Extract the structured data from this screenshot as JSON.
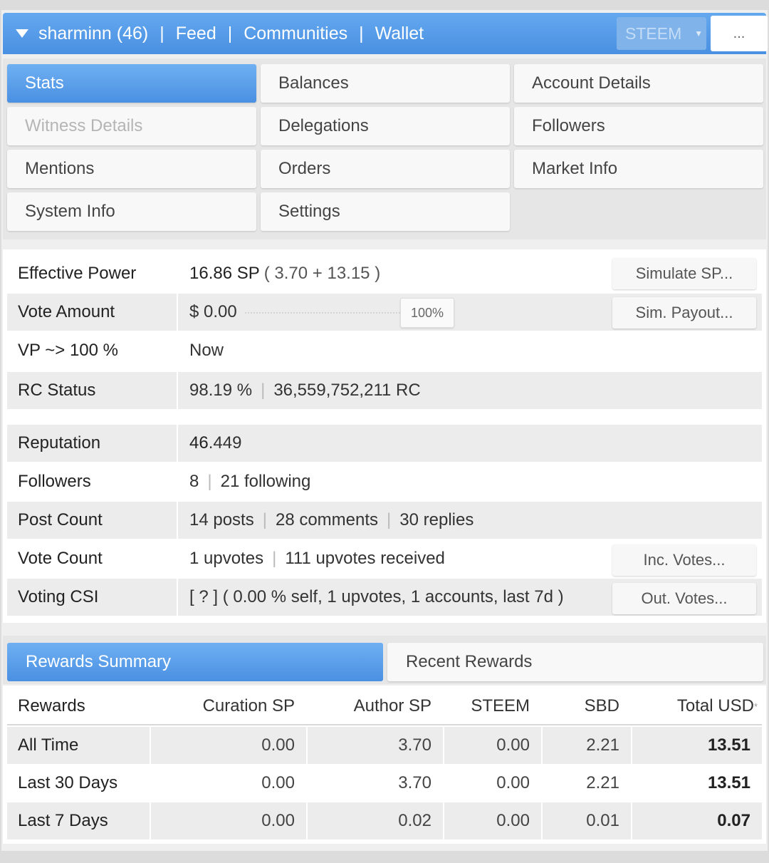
{
  "header": {
    "user": "sharminn (46)",
    "nav": [
      "Feed",
      "Communities",
      "Wallet"
    ],
    "separator": "|",
    "coin": "STEEM",
    "more": "..."
  },
  "menu": {
    "items": [
      {
        "label": "Stats",
        "state": "active"
      },
      {
        "label": "Balances",
        "state": "normal"
      },
      {
        "label": "Account Details",
        "state": "normal"
      },
      {
        "label": "Witness Details",
        "state": "disabled"
      },
      {
        "label": "Delegations",
        "state": "normal"
      },
      {
        "label": "Followers",
        "state": "normal"
      },
      {
        "label": "Mentions",
        "state": "normal"
      },
      {
        "label": "Orders",
        "state": "normal"
      },
      {
        "label": "Market Info",
        "state": "normal"
      },
      {
        "label": "System Info",
        "state": "normal"
      },
      {
        "label": "Settings",
        "state": "normal"
      }
    ]
  },
  "stats": {
    "effective_power": {
      "label": "Effective Power",
      "value": "16.86 SP",
      "detail": "( 3.70 + 13.15 )",
      "button": "Simulate SP..."
    },
    "vote_amount": {
      "label": "Vote Amount",
      "value": "$ 0.00",
      "slider_percent": "100%",
      "button": "Sim. Payout..."
    },
    "vp": {
      "label": "VP ~> 100 %",
      "value": "Now"
    },
    "rc_status": {
      "label": "RC Status",
      "percent": "98.19 %",
      "amount": "36,559,752,211 RC"
    },
    "reputation": {
      "label": "Reputation",
      "whole": "46",
      "decimal": ".449"
    },
    "followers": {
      "label": "Followers",
      "count": "8",
      "following": "21 following"
    },
    "post_count": {
      "label": "Post Count",
      "posts": "14 posts",
      "comments": "28 comments",
      "replies": "30 replies"
    },
    "vote_count": {
      "label": "Vote Count",
      "upvotes": "1 upvotes",
      "received": "111 upvotes received",
      "button": "Inc. Votes..."
    },
    "voting_csi": {
      "label": "Voting CSI",
      "value": "[ ? ] ( 0.00 % self, 1 upvotes, 1 accounts, last 7d )",
      "button": "Out. Votes..."
    }
  },
  "rewards": {
    "tabs": [
      {
        "label": "Rewards Summary",
        "state": "active"
      },
      {
        "label": "Recent Rewards",
        "state": "normal"
      }
    ],
    "headers": [
      "Rewards",
      "Curation SP",
      "Author SP",
      "STEEM",
      "SBD",
      "Total USD"
    ],
    "total_usd_mark": "*",
    "rows": [
      {
        "period": "All Time",
        "curation_sp": "0.00",
        "author_sp": "3.70",
        "steem": "0.00",
        "sbd": "2.21",
        "total_usd": "13.51"
      },
      {
        "period": "Last 30 Days",
        "curation_sp": "0.00",
        "author_sp": "3.70",
        "steem": "0.00",
        "sbd": "2.21",
        "total_usd": "13.51"
      },
      {
        "period": "Last 7 Days",
        "curation_sp": "0.00",
        "author_sp": "0.02",
        "steem": "0.00",
        "sbd": "0.01",
        "total_usd": "0.07"
      }
    ]
  }
}
